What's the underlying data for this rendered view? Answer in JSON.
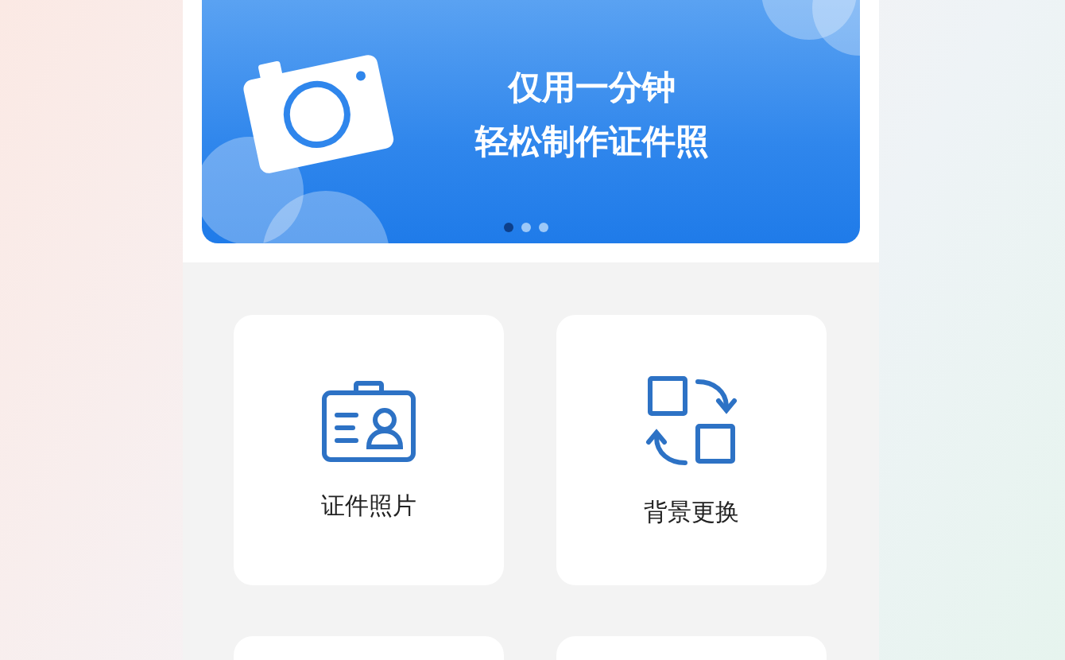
{
  "banner": {
    "lines": [
      "仅用一分钟",
      "轻松制作证件照"
    ],
    "dots": [
      {
        "selected": true
      },
      {
        "selected": false
      },
      {
        "selected": false
      }
    ]
  },
  "tiles": [
    {
      "kind": "id-card",
      "label": "证件照片"
    },
    {
      "kind": "swap",
      "label": "背景更换"
    }
  ]
}
